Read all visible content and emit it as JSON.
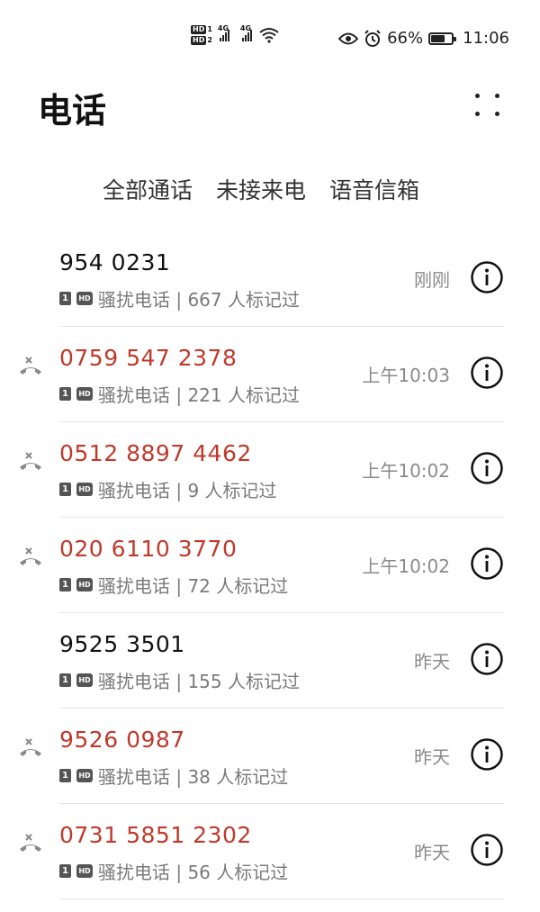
{
  "status_bar": {
    "sim1": "HD",
    "sim1_index": "1",
    "sim2": "HD",
    "sim2_index": "2",
    "net1": "4G",
    "net2": "4G",
    "battery_percent": "66%",
    "battery_level": 0.66,
    "time": "11:06"
  },
  "header": {
    "title": "电话"
  },
  "tabs": [
    {
      "label": "全部通话",
      "active": true
    },
    {
      "label": "未接来电",
      "active": false
    },
    {
      "label": "语音信箱",
      "active": false
    }
  ],
  "calls": [
    {
      "number": "954 0231",
      "sim": "1",
      "hd": "HD",
      "tag": "骚扰电话 | 667 人标记过",
      "time": "刚刚",
      "missed": false
    },
    {
      "number": "0759 547 2378",
      "sim": "1",
      "hd": "HD",
      "tag": "骚扰电话 | 221 人标记过",
      "time": "上午10:03",
      "missed": true
    },
    {
      "number": "0512 8897 4462",
      "sim": "1",
      "hd": "HD",
      "tag": "骚扰电话 | 9 人标记过",
      "time": "上午10:02",
      "missed": true
    },
    {
      "number": "020 6110 3770",
      "sim": "1",
      "hd": "HD",
      "tag": "骚扰电话 | 72 人标记过",
      "time": "上午10:02",
      "missed": true
    },
    {
      "number": "9525 3501",
      "sim": "1",
      "hd": "HD",
      "tag": "骚扰电话 | 155 人标记过",
      "time": "昨天",
      "missed": false
    },
    {
      "number": "9526 0987",
      "sim": "1",
      "hd": "HD",
      "tag": "骚扰电话 | 38 人标记过",
      "time": "昨天",
      "missed": true
    },
    {
      "number": "0731 5851 2302",
      "sim": "1",
      "hd": "HD",
      "tag": "骚扰电话 | 56 人标记过",
      "time": "昨天",
      "missed": true
    }
  ],
  "colors": {
    "accent": "#1a5fb4",
    "missed": "#c0392b"
  }
}
